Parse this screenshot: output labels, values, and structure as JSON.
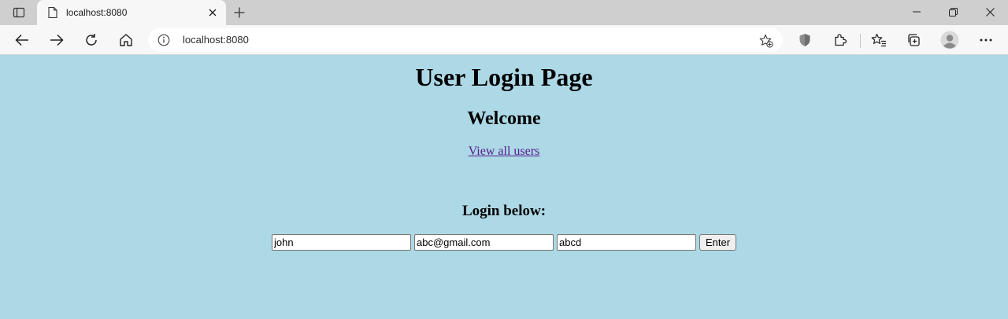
{
  "browser": {
    "tab": {
      "title": "localhost:8080",
      "favicon": "page-icon"
    },
    "address_bar": {
      "url": "localhost:8080"
    }
  },
  "page": {
    "title": "User Login Page",
    "welcome": "Welcome",
    "users_link": "View all users",
    "login_heading": "Login below:",
    "form": {
      "name_value": "john",
      "email_value": "abc@gmail.com",
      "password_value": "abcd",
      "submit_label": "Enter"
    }
  },
  "colors": {
    "page_background": "#add8e6",
    "link": "#551a8b",
    "chrome": "#cfcfcf",
    "toolbar": "#f7f7f7"
  }
}
